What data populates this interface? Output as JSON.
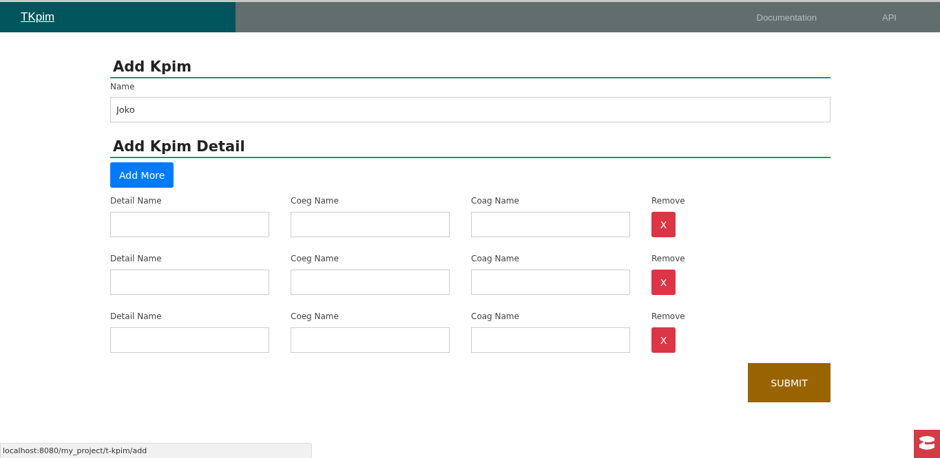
{
  "navbar": {
    "brand": "TKpim",
    "links": [
      {
        "label": "Documentation"
      },
      {
        "label": "API"
      }
    ]
  },
  "kpim": {
    "heading": "Add Kpim",
    "name_field": {
      "label": "Name",
      "value": "Joko"
    }
  },
  "detail": {
    "heading": "Add Kpim Detail",
    "add_button": "Add More",
    "rows": [
      {
        "fields": [
          {
            "label": "Detail Name"
          },
          {
            "label": "Coeg Name"
          },
          {
            "label": "Coag Name"
          }
        ],
        "remove_label": "Remove",
        "remove_button": "X"
      },
      {
        "fields": [
          {
            "label": "Detail Name"
          },
          {
            "label": "Coeg Name"
          },
          {
            "label": "Coag Name"
          }
        ],
        "remove_label": "Remove",
        "remove_button": "X"
      },
      {
        "fields": [
          {
            "label": "Detail Name"
          },
          {
            "label": "Coeg Name"
          },
          {
            "label": "Coag Name"
          }
        ],
        "remove_label": "Remove",
        "remove_button": "X"
      }
    ]
  },
  "submit_button": "SUBMIT",
  "status_bar": {
    "url": "localhost:8080/my_project/t-kpim/add"
  }
}
